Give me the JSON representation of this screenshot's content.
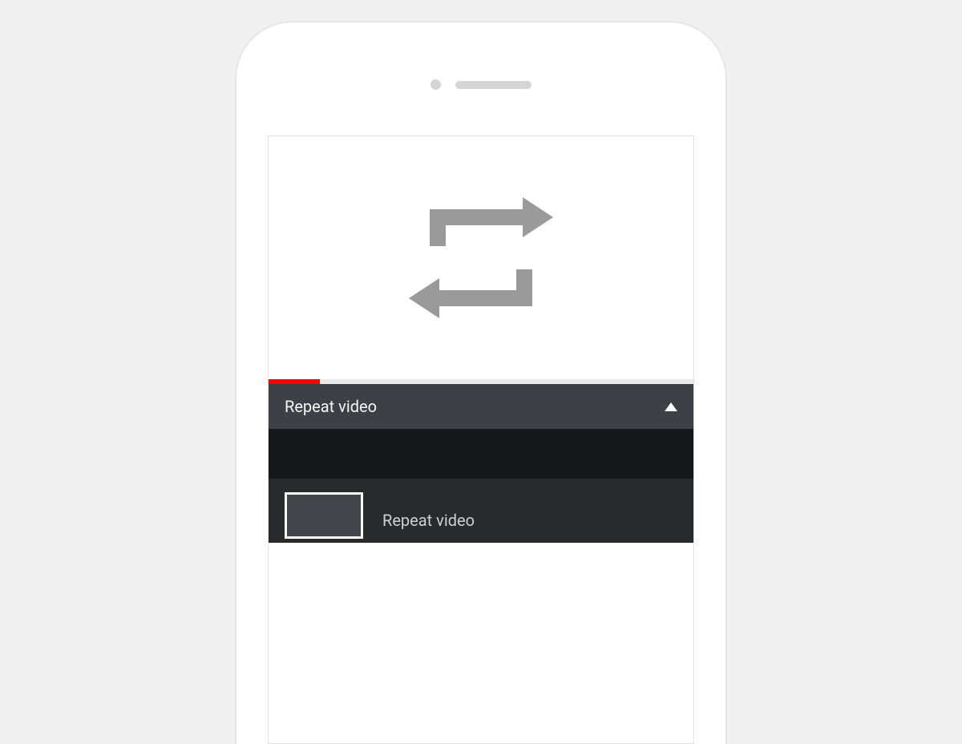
{
  "header": {
    "title": "Repeat video"
  },
  "playlist": {
    "items": [
      {
        "label": "Repeat video"
      }
    ]
  },
  "progress": {
    "percent": 12
  },
  "icons": {
    "repeat": "repeat-icon",
    "collapse": "collapse-up-icon"
  },
  "colors": {
    "accent": "#ff0000",
    "headerBg": "#3d4044",
    "listBg": "#282a2c",
    "darkBg": "#16181a"
  }
}
